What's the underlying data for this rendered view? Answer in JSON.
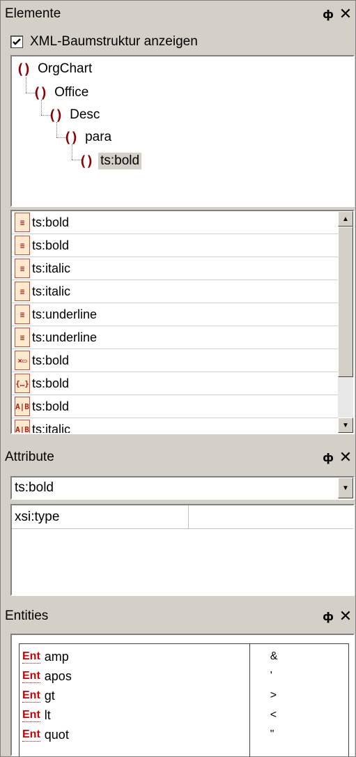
{
  "elemente": {
    "title": "Elemente",
    "pin": "ф",
    "close": "✕",
    "checkbox_label": "XML-Baumstruktur anzeigen",
    "checkbox_checked": true,
    "tree": [
      "OrgChart",
      "Office",
      "Desc",
      "para",
      "ts:bold"
    ],
    "selected": "ts:bold",
    "list": [
      {
        "icon": "element-before-icon",
        "glyph": "≡",
        "label": "ts:bold"
      },
      {
        "icon": "element-after-icon",
        "glyph": "≡",
        "label": "ts:bold"
      },
      {
        "icon": "element-before-icon",
        "glyph": "≡",
        "label": "ts:italic"
      },
      {
        "icon": "element-after-icon",
        "glyph": "≡",
        "label": "ts:italic"
      },
      {
        "icon": "element-before-icon",
        "glyph": "≡",
        "label": "ts:underline"
      },
      {
        "icon": "element-after-icon",
        "glyph": "≡",
        "label": "ts:underline"
      },
      {
        "icon": "clear-element-icon",
        "glyph": "×▭",
        "label": "ts:bold"
      },
      {
        "icon": "enclose-icon",
        "glyph": "{…}",
        "label": "ts:bold"
      },
      {
        "icon": "convert-icon",
        "glyph": "A|B",
        "label": "ts:bold"
      },
      {
        "icon": "convert-icon",
        "glyph": "A|B",
        "label": "ts:italic"
      }
    ]
  },
  "attribute": {
    "title": "Attribute",
    "pin": "ф",
    "close": "✕",
    "combo_value": "ts:bold",
    "rows": [
      {
        "name": "xsi:type",
        "value": ""
      }
    ]
  },
  "entities": {
    "title": "Entities",
    "pin": "ф",
    "close": "✕",
    "icon_text": "Ent",
    "rows": [
      {
        "name": "amp",
        "value": "&"
      },
      {
        "name": "apos",
        "value": "'"
      },
      {
        "name": "gt",
        "value": ">"
      },
      {
        "name": "lt",
        "value": "<"
      },
      {
        "name": "quot",
        "value": "\""
      }
    ]
  }
}
